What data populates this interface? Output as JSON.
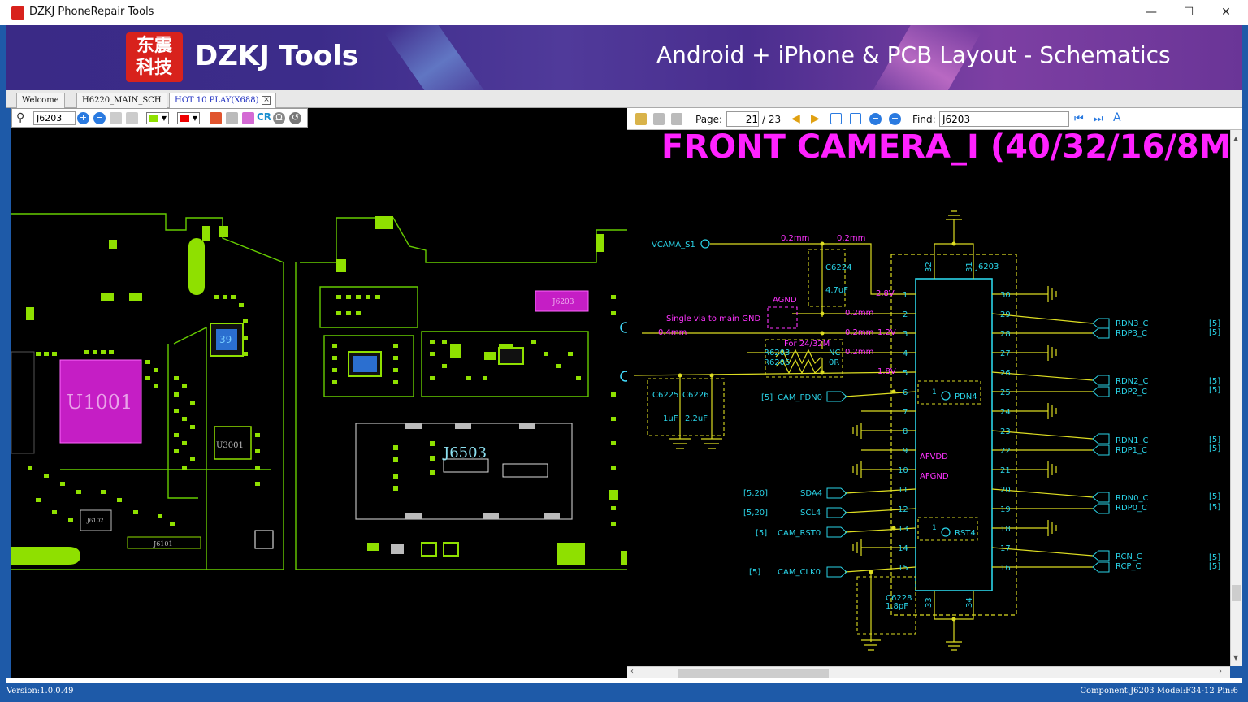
{
  "window": {
    "title": "DZKJ PhoneRepair Tools",
    "minimize": "—",
    "maximize": "☐",
    "close": "✕"
  },
  "banner": {
    "logo_line1": "东震",
    "logo_line2": "科技",
    "brand": "DZKJ Tools",
    "tagline": "Android + iPhone & PCB Layout - Schematics"
  },
  "tabs": [
    {
      "label": "Welcome"
    },
    {
      "label": "H6220_MAIN_SCH"
    },
    {
      "label": "HOT 10 PLAY(X688)",
      "active": true
    }
  ],
  "pcb_toolbar": {
    "search_value": "J6203"
  },
  "pcb": {
    "labels": {
      "u1001": "U1001",
      "j6503": "J6503",
      "j6203": "J6203",
      "u3001": "U3001",
      "j6102": "J6102",
      "j6101": "J6101",
      "pad39": "39"
    }
  },
  "sch_toolbar": {
    "page_label": "Page:",
    "page_value": "21",
    "page_total": "/ 23",
    "find_label": "Find:",
    "find_value": "J6203"
  },
  "schematic": {
    "title": "FRONT CAMERA_I (40/32/16/8M",
    "refdes": "J6203",
    "nets": {
      "vcama": "VCAMA_S1",
      "cam_pdn": "CAM_PDN0",
      "sda": "SDA4",
      "scl": "SCL4",
      "cam_rst": "CAM_RST0",
      "cam_clk": "CAM_CLK0",
      "pdn4": "PDN4",
      "rst4": "RST4",
      "afvdd": "AFVDD",
      "afgnd": "AFGND",
      "agnd": "AGND"
    },
    "refs": {
      "pdn": "[5]",
      "sda": "[5,20]",
      "scl": "[5,20]",
      "rst": "[5]",
      "clk": "[5]"
    },
    "notes": {
      "single_via": "Single via to main GND",
      "for": "For 24/32M"
    },
    "widths": {
      "w1": "0.2mm",
      "w2": "0.2mm",
      "w3": "0.2mm",
      "w4": "0.4mm",
      "w5": "0.2mm",
      "w6": "0.2mm"
    },
    "volts": {
      "v28": "2.8V",
      "v12": "1.2V",
      "v18": "1.8V"
    },
    "parts": {
      "c6224": "C6224",
      "c6224_v": "4.7uF",
      "c6225": "C6225",
      "c6225_v": "1uF",
      "c6226": "C6226",
      "c6226_v": "2.2uF",
      "c6228": "C6228",
      "c6228_v": "1.8pF",
      "r6203": "R6203",
      "r6203_v": "NC",
      "r6206": "R6206",
      "r6206_v": "0R"
    },
    "pin_numbers": {
      "p32": "32",
      "p31": "31",
      "p33": "33",
      "p34": "34"
    },
    "left_pins": [
      "1",
      "2",
      "3",
      "4",
      "5",
      "6",
      "7",
      "8",
      "9",
      "10",
      "11",
      "12",
      "13",
      "14",
      "15"
    ],
    "right_pins": [
      "30",
      "29",
      "28",
      "27",
      "26",
      "25",
      "24",
      "23",
      "22",
      "21",
      "20",
      "19",
      "18",
      "17",
      "16"
    ],
    "diff_nets": [
      {
        "n": "RDN3_C",
        "p": "RDP3_C"
      },
      {
        "n": "RDN2_C",
        "p": "RDP2_C"
      },
      {
        "n": "RDN1_C",
        "p": "RDP1_C"
      },
      {
        "n": "RDN0_C",
        "p": "RDP0_C"
      },
      {
        "n": "RCN_C",
        "p": "RCP_C"
      }
    ],
    "diff_ref": "[5]",
    "pdn_pin": "1",
    "rst_pin": "1"
  },
  "status": {
    "version": "Version:1.0.0.49",
    "component": "Component:J6203 Model:F34-12 Pin:6"
  },
  "colors": {
    "pcb_green": "#88f000",
    "component_magenta": "#cc22cc",
    "schematic_title": "#ff22ff",
    "net_cyan": "#22ddee",
    "wire_yellow": "#dddd22"
  }
}
